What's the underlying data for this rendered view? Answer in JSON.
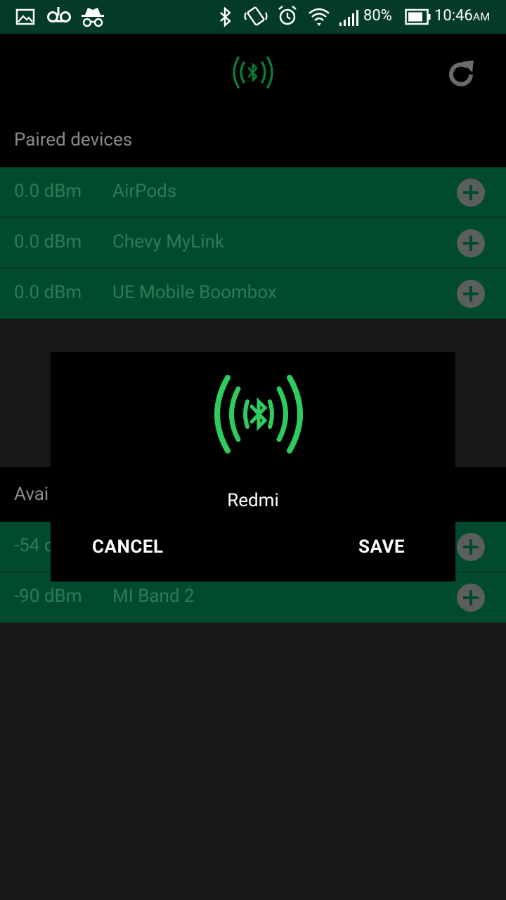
{
  "status_bar": {
    "icons": [
      "image-icon",
      "voicemail-icon",
      "incognito-icon",
      "bluetooth-icon",
      "vibrate-icon",
      "alarm-icon",
      "wifi-icon",
      "signal-icon"
    ],
    "battery": "80%",
    "time": "10:46",
    "ampm": "AM"
  },
  "app_bar": {
    "logo_icon": "bluetooth-signal-icon",
    "refresh_icon": "refresh-icon"
  },
  "paired": {
    "title": "Paired devices",
    "devices": [
      {
        "rssi": "0.0 dBm",
        "name": "AirPods"
      },
      {
        "rssi": "0.0 dBm",
        "name": "Chevy MyLink"
      },
      {
        "rssi": "0.0 dBm",
        "name": "UE Mobile Boombox"
      }
    ]
  },
  "available": {
    "title": "Avai",
    "devices": [
      {
        "rssi": "-54 d",
        "name": ""
      },
      {
        "rssi": "-90 dBm",
        "name": "MI Band 2"
      }
    ]
  },
  "dialog": {
    "icon": "bluetooth-signal-icon",
    "device_name": "Redmi",
    "cancel_label": "CANCEL",
    "save_label": "SAVE"
  },
  "colors": {
    "accent": "#2ecc5e",
    "row_bg": "#024a2e",
    "status_bg": "#033a2a"
  }
}
